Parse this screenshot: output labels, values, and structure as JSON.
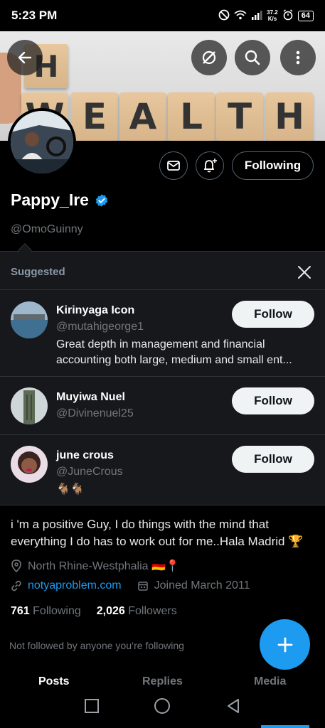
{
  "status_bar": {
    "time": "5:23 PM",
    "net_speed_value": "37.2",
    "net_speed_unit": "K/s",
    "battery": "64"
  },
  "banner": {
    "top_letters": [
      "H"
    ],
    "bottom_letters": [
      "W",
      "E",
      "A",
      "L",
      "T",
      "H"
    ]
  },
  "profile": {
    "display_name": "Pappy_Ire",
    "handle": "@OmoGuinny",
    "following_button": "Following",
    "bio": "i 'm a positive Guy, I do things with the mind that everything I do has to work out for me..Hala Madrid 🏆",
    "location": "North Rhine-Westphalia 🇩🇪📍",
    "website": "notyaproblem.com",
    "joined": "Joined March 2011",
    "following_count": "761",
    "following_label": "Following",
    "followers_count": "2,026",
    "followers_label": "Followers",
    "not_followed_text": "Not followed by anyone you’re following"
  },
  "suggested": {
    "title": "Suggested",
    "users": [
      {
        "name": "Kirinyaga Icon",
        "handle": "@mutahigeorge1",
        "bio": "Great depth in management and financial accounting both large, medium and small ent...",
        "button": "Follow"
      },
      {
        "name": "Muyiwa Nuel",
        "handle": "@Divinenuel25",
        "bio": "",
        "button": "Follow"
      },
      {
        "name": "june crous",
        "handle": "@JuneCrous",
        "bio": "🐐🐐",
        "button": "Follow"
      }
    ]
  },
  "tabs": [
    "Posts",
    "Replies",
    "Media"
  ],
  "colors": {
    "accent": "#1d9bf0",
    "background": "#000000",
    "card": "#16181c",
    "muted": "#71767b"
  }
}
